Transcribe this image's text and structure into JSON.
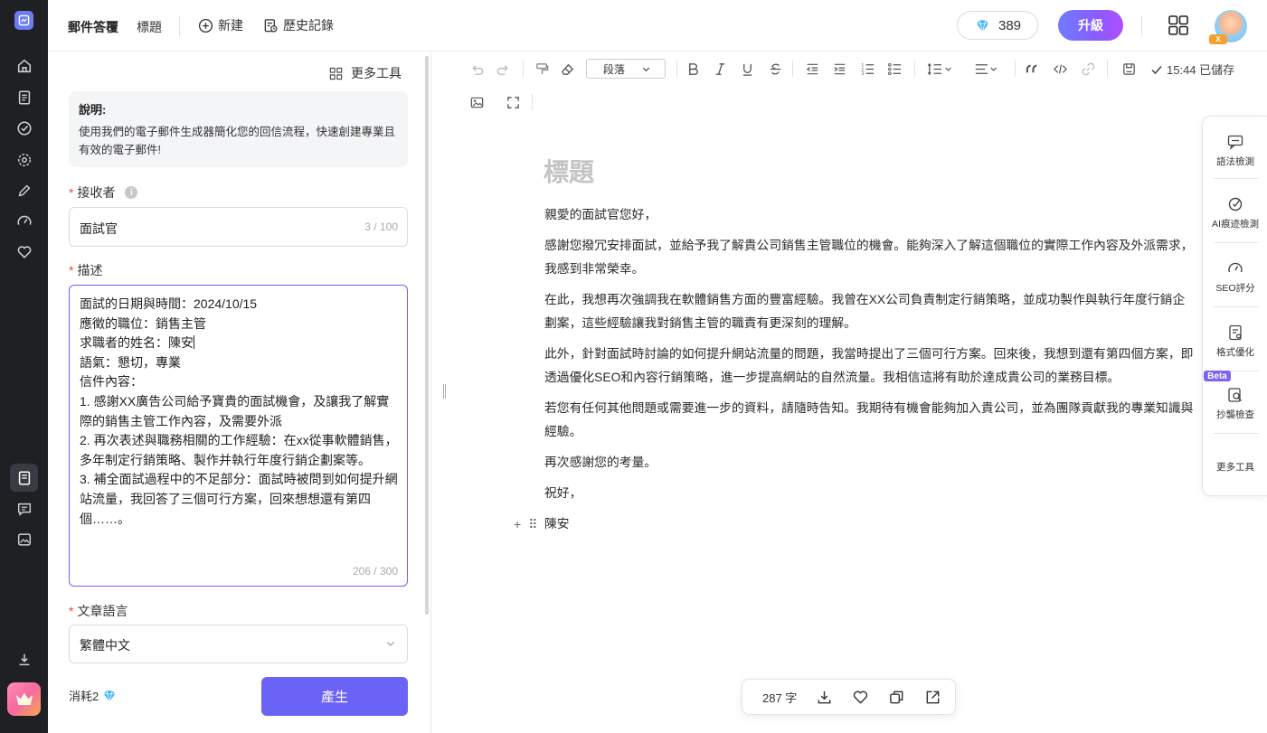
{
  "app": {
    "title": "郵件答覆",
    "tab_label": "標題",
    "new_label": "新建",
    "history_label": "歷史記錄",
    "points": "389",
    "upgrade_label": "升級",
    "vip_badge": "X",
    "accent_color": "#6b63f5"
  },
  "rail": {
    "icons": [
      "app-logo-icon",
      "home-icon",
      "document-icon",
      "check-circle-icon",
      "settings-icon",
      "pen-icon",
      "speedometer-icon",
      "heart-icon",
      "notebook-icon",
      "chat-icon",
      "image-icon",
      "download-icon",
      "crown-icon"
    ]
  },
  "form": {
    "more_tools_label": "更多工具",
    "note_title": "說明:",
    "note_body": "使用我們的電子郵件生成器簡化您的回信流程，快速創建專業且有效的電子郵件!",
    "recipient_label": "接收者",
    "recipient_value": "面試官",
    "recipient_count": "3 / 100",
    "description_label": "描述",
    "description_lines": [
      "面試的日期與時間：2024/10/15",
      "應徵的職位：銷售主管",
      "求職者的姓名：陳安",
      "語氣：懇切，專業",
      "信件內容：",
      "1. 感謝XX廣告公司給予寶貴的面試機會，及讓我了解實際的銷售主管工作內容，及需要外派",
      "2. 再次表述與職務相關的工作經驗：在xx從事軟體銷售，多年制定行銷策略、製作并執行年度行銷企劃案等。",
      "3. 補全面試過程中的不足部分：面試時被問到如何提升網站流量，我回答了三個可行方案，回來想想還有第四個……。"
    ],
    "description_count": "206 / 300",
    "language_label": "文章語言",
    "language_value": "繁體中文",
    "cost_label": "消耗2",
    "generate_label": "產生"
  },
  "editor": {
    "paragraph_style": "段落",
    "saved_status": "15:44 已儲存",
    "doc_title": "標題",
    "paragraphs": [
      "親愛的面試官您好，",
      "感謝您撥冗安排面試，並給予我了解貴公司銷售主管職位的機會。能夠深入了解這個職位的實際工作內容及外派需求，我感到非常榮幸。",
      "在此，我想再次強調我在軟體銷售方面的豐富經驗。我曾在XX公司負責制定行銷策略，並成功製作與執行年度行銷企劃案，這些經驗讓我對銷售主管的職責有更深刻的理解。",
      "此外，針對面試時討論的如何提升網站流量的問題，我當時提出了三個可行方案。回來後，我想到還有第四個方案，即透過優化SEO和內容行銷策略，進一步提高網站的自然流量。我相信這將有助於達成貴公司的業務目標。",
      "若您有任何其他問題或需要進一步的資料，請隨時告知。我期待有機會能夠加入貴公司，並為團隊貢獻我的專業知識與經驗。",
      "再次感謝您的考量。",
      "祝好，"
    ],
    "signature": "陳安",
    "word_count": "287 字"
  },
  "right_tools": {
    "grammar": "語法檢測",
    "ai_detect": "AI痕迹檢測",
    "seo": "SEO評分",
    "format": "格式優化",
    "beta": "Beta",
    "plagiarism": "抄襲檢查",
    "more": "更多工具"
  }
}
